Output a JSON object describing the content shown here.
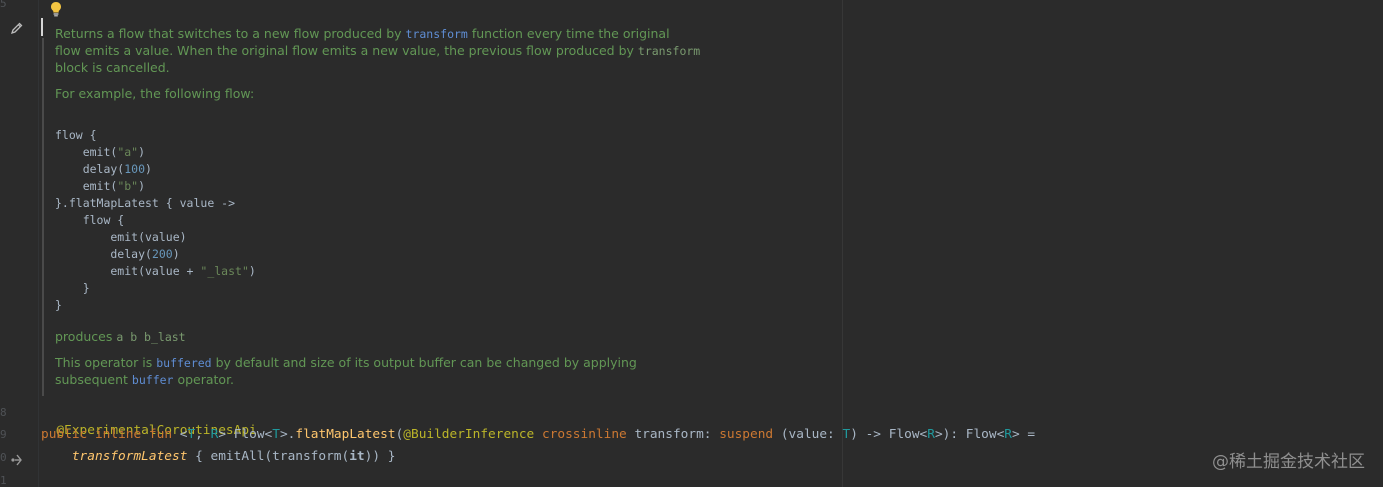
{
  "gutter": {
    "line_numbers": [
      "5",
      "8",
      "9",
      "0",
      "1"
    ]
  },
  "doc": {
    "p1": {
      "l1_a": "Returns a flow that switches to a new flow produced by ",
      "l1_code": "transform",
      "l1_b": " function every time the original",
      "l2_a": "flow emits a value. When the original flow emits a new value, the previous flow produced by ",
      "l2_code": "transform",
      "l3": "block is cancelled."
    },
    "p2": "For example, the following flow:",
    "example_code": [
      "flow {",
      "    emit(\"a\")",
      "    delay(100)",
      "    emit(\"b\")",
      "}.flatMapLatest { value ->",
      "    flow {",
      "        emit(value)",
      "        delay(200)",
      "        emit(value + \"_last\")",
      "    }",
      "}"
    ],
    "produces_label": "produces ",
    "produces_code": "a b b_last",
    "p4": {
      "a": "This operator is ",
      "code1": "buffered",
      "b": " by default and size of its output buffer can be changed by applying",
      "c": "subsequent ",
      "code2": "buffer",
      "d": " operator."
    }
  },
  "code": {
    "annotation": "@ExperimentalCoroutinesApi",
    "sig": {
      "kw_public": "public",
      "kw_inline": "inline",
      "kw_fun": "fun",
      "lt": " <",
      "T": "T",
      "comma": ", ",
      "R": "R",
      "gt_flow": "> Flow<",
      "T2": "T",
      "dot": ">.",
      "fn": "flatMapLatest",
      "paren": "(",
      "ann": "@BuilderInference",
      "kw_crossinline": "crossinline",
      "param": " transform: ",
      "kw_suspend": "suspend",
      "lambda_a": " (value: ",
      "T3": "T",
      "lambda_b": ") -> Flow<",
      "R2": "R",
      "lambda_c": ">): Flow<",
      "R3": "R",
      "end": "> ="
    },
    "body": {
      "fn": "transformLatest",
      "a": " { emitAll(transform(",
      "it": "it",
      "b": ")) }"
    }
  },
  "watermark": "@稀土掘金技术社区",
  "icons": {
    "bulb": "lightbulb-icon",
    "edit": "pencil-icon",
    "gutter_marker": "implementation-marker-icon"
  }
}
